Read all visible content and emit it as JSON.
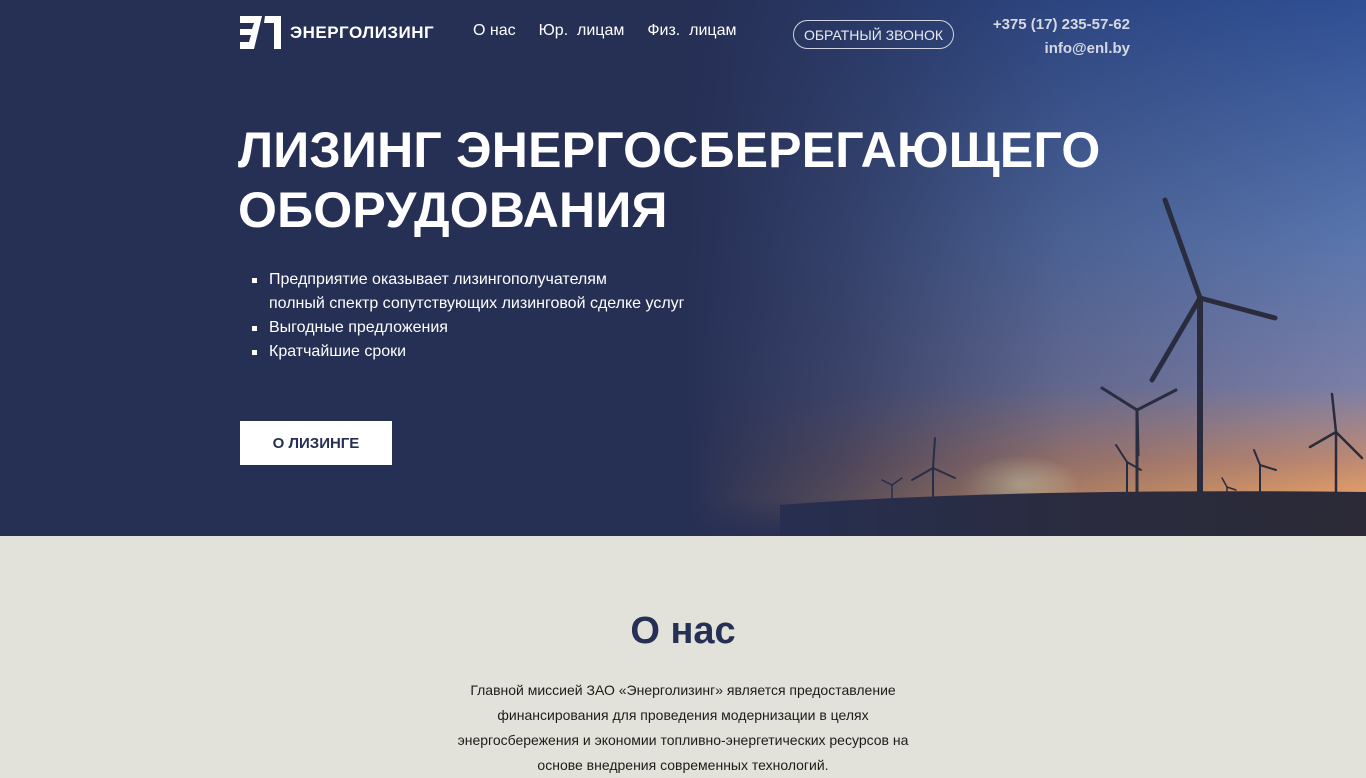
{
  "header": {
    "logo_text": "ЭНЕРГОЛИЗИНГ",
    "nav": [
      {
        "label": "О нас"
      },
      {
        "label": "Юр.  лицам"
      },
      {
        "label": "Физ.  лицам"
      }
    ],
    "callback_label": "ОБРАТНЫЙ ЗВОНОК",
    "phone": "+375 (17) 235-57-62",
    "email": "info@enl.by"
  },
  "hero": {
    "title_lines": [
      "ЛИЗИНГ ЭНЕРГОСБЕРЕГАЮЩЕГО",
      "ОБОРУДОВАНИЯ"
    ],
    "bullets": [
      {
        "lines": [
          "Предприятие оказывает лизингополучателям",
          "полный спектр сопутствующих лизинговой сделке услуг"
        ]
      },
      {
        "lines": [
          "Выгодные предложения"
        ]
      },
      {
        "lines": [
          "Кратчайшие сроки"
        ]
      }
    ],
    "cta_label": "О ЛИЗИНГЕ"
  },
  "about": {
    "title": "О нас",
    "text_lines": [
      "Главной миссией ЗАО «Энерголизинг» является предоставление",
      "финансирования для проведения модернизации в целях",
      "энергосбережения и экономии топливно-энергетических ресурсов на",
      "основе внедрения современных технологий."
    ]
  },
  "colors": {
    "hero_bg": "#262f54",
    "about_bg": "#e2e2da",
    "accent": "#ffffff"
  }
}
